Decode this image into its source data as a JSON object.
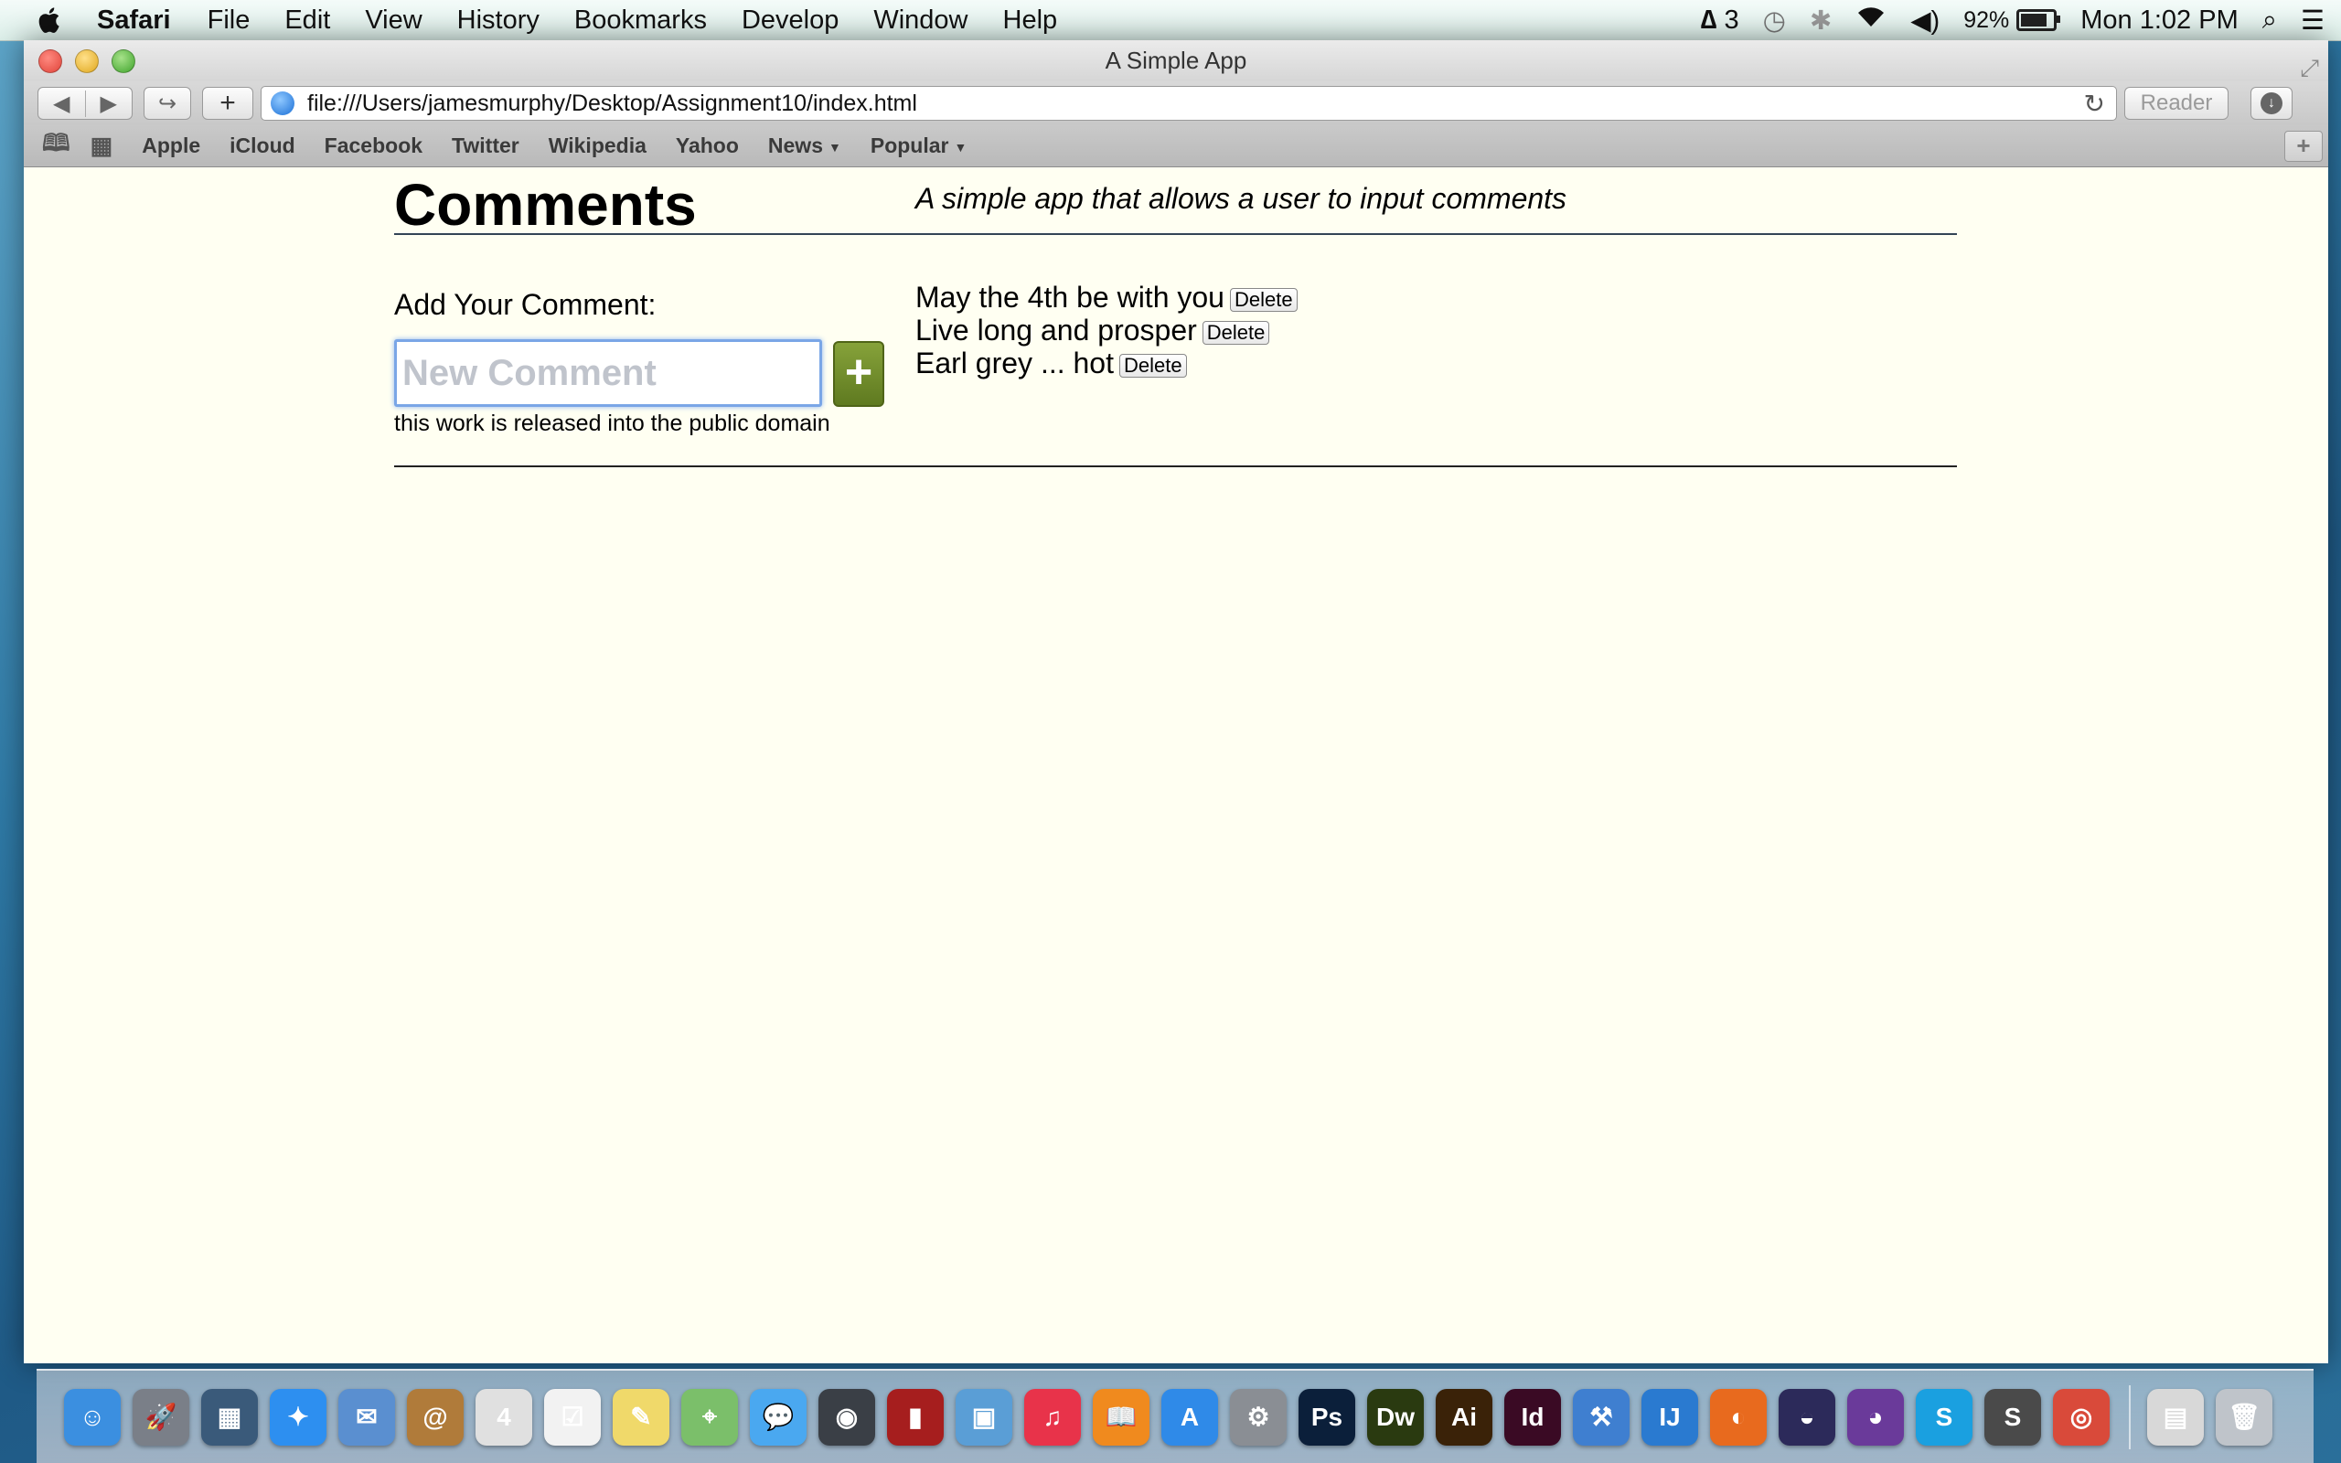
{
  "menubar": {
    "app_name": "Safari",
    "items": [
      "File",
      "Edit",
      "View",
      "History",
      "Bookmarks",
      "Develop",
      "Window",
      "Help"
    ],
    "status": {
      "adobe_count": "3",
      "battery_percent": "92%",
      "battery_level": 0.92,
      "clock": "Mon 1:02 PM"
    }
  },
  "window": {
    "title": "A Simple App",
    "url": "file:///Users/jamesmurphy/Desktop/Assignment10/index.html",
    "reader_label": "Reader",
    "bookmarks": [
      "Apple",
      "iCloud",
      "Facebook",
      "Twitter",
      "Wikipedia",
      "Yahoo",
      "News",
      "Popular"
    ]
  },
  "page": {
    "title": "Comments",
    "tagline": "A simple app that allows a user to input comments",
    "add_label": "Add Your Comment:",
    "input_placeholder": "New Comment",
    "add_button_label": "+",
    "comments": [
      {
        "text": "May the 4th be with you",
        "delete_label": "Delete"
      },
      {
        "text": "Live long and prosper",
        "delete_label": "Delete"
      },
      {
        "text": "Earl grey ... hot",
        "delete_label": "Delete"
      }
    ],
    "footer": "this work is released into the public domain"
  },
  "colors": {
    "page_background": "#fffff2",
    "add_button": "#6f8a2a",
    "input_focus": "#7aa6e6"
  },
  "dock": {
    "apps": [
      {
        "name": "finder-icon",
        "glyph": "☺",
        "color": "#3b8fe0"
      },
      {
        "name": "launchpad-icon",
        "glyph": "🚀",
        "color": "#7a7f88"
      },
      {
        "name": "mission-control-icon",
        "glyph": "▦",
        "color": "#3a5a7a"
      },
      {
        "name": "safari-icon",
        "glyph": "✦",
        "color": "#2d8ff0"
      },
      {
        "name": "mail-icon",
        "glyph": "✉",
        "color": "#5a8fd0"
      },
      {
        "name": "contacts-icon",
        "glyph": "@",
        "color": "#b07b3a"
      },
      {
        "name": "calendar-icon",
        "glyph": "4",
        "color": "#e0e0e0"
      },
      {
        "name": "reminders-icon",
        "glyph": "☑",
        "color": "#f2f2f2"
      },
      {
        "name": "notes-icon",
        "glyph": "✎",
        "color": "#f0d96a"
      },
      {
        "name": "maps-icon",
        "glyph": "⌖",
        "color": "#7bbf6a"
      },
      {
        "name": "messages-icon",
        "glyph": "💬",
        "color": "#4aa8f0"
      },
      {
        "name": "facetime-icon",
        "glyph": "◉",
        "color": "#3a3f46"
      },
      {
        "name": "photo-booth-icon",
        "glyph": "▮",
        "color": "#a61e1e"
      },
      {
        "name": "iphoto-icon",
        "glyph": "▣",
        "color": "#5a9ed6"
      },
      {
        "name": "itunes-icon",
        "glyph": "♫",
        "color": "#e8334a"
      },
      {
        "name": "ibooks-icon",
        "glyph": "📖",
        "color": "#f08a1e"
      },
      {
        "name": "app-store-icon",
        "glyph": "A",
        "color": "#2f8ae8"
      },
      {
        "name": "system-preferences-icon",
        "glyph": "⚙",
        "color": "#8a8e94"
      },
      {
        "name": "photoshop-icon",
        "glyph": "Ps",
        "color": "#0b1f3a"
      },
      {
        "name": "dreamweaver-icon",
        "glyph": "Dw",
        "color": "#2a3a10"
      },
      {
        "name": "illustrator-icon",
        "glyph": "Ai",
        "color": "#3a2208"
      },
      {
        "name": "indesign-icon",
        "glyph": "Id",
        "color": "#3a0a24"
      },
      {
        "name": "xcode-icon",
        "glyph": "⚒",
        "color": "#3f7fd0"
      },
      {
        "name": "intellij-icon",
        "glyph": "IJ",
        "color": "#2a7ad0"
      },
      {
        "name": "firefox-icon",
        "glyph": "◐",
        "color": "#e86a1e"
      },
      {
        "name": "eclipse-icon",
        "glyph": "◒",
        "color": "#2c2a5a"
      },
      {
        "name": "github-icon",
        "glyph": "◕",
        "color": "#6a3a9a"
      },
      {
        "name": "skype-icon",
        "glyph": "S",
        "color": "#1aa0e0"
      },
      {
        "name": "sublime-text-icon",
        "glyph": "S",
        "color": "#4a4a4a"
      },
      {
        "name": "chrome-icon",
        "glyph": "◎",
        "color": "#d94a3a"
      }
    ],
    "trailing": [
      {
        "name": "documents-stack-icon",
        "glyph": "▤",
        "color": "#d8d8d8"
      },
      {
        "name": "trash-icon",
        "glyph": "🗑",
        "color": "#bfc4ca"
      }
    ]
  }
}
